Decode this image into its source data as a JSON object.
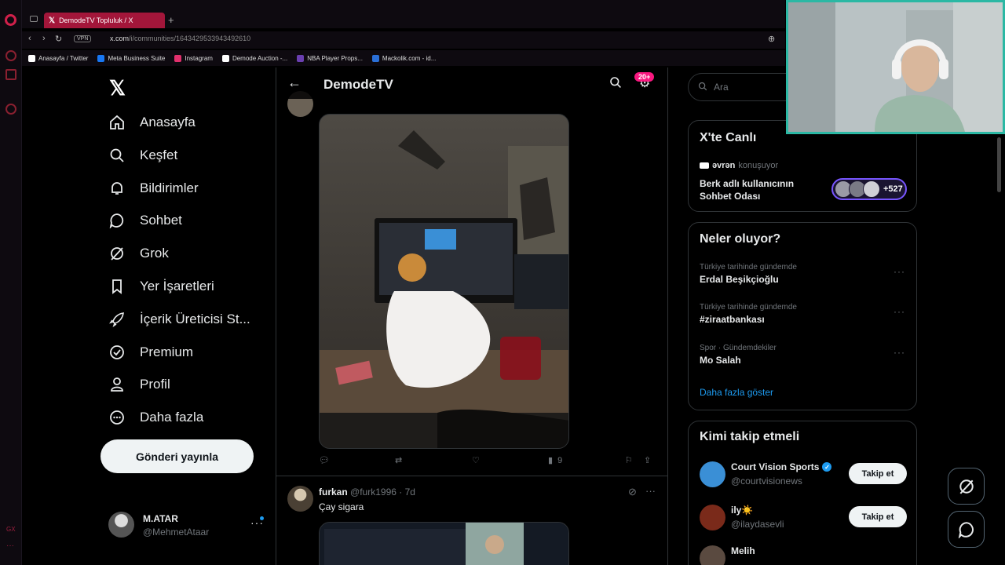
{
  "browser": {
    "tab_title": "DemodeTV Topluluk / X",
    "url_host": "x.com",
    "url_path": "/i/communities/1643429533943492610",
    "vpn_label": "VPN",
    "bookmarks": [
      {
        "label": "Anasayfa / Twitter",
        "color": "#ffffff"
      },
      {
        "label": "Meta Business Suite",
        "color": "#1877f2"
      },
      {
        "label": "Instagram",
        "color": "#e1306c"
      },
      {
        "label": "Demode Auction -...",
        "color": "#ffffff"
      },
      {
        "label": "NBA Player Props...",
        "color": "#6a3fb0"
      },
      {
        "label": "Mackolik.com - id...",
        "color": "#2a6fd6"
      }
    ],
    "rail_label": "GX"
  },
  "sidebar": {
    "items": [
      {
        "label": "Anasayfa",
        "icon": "home-icon"
      },
      {
        "label": "Keşfet",
        "icon": "search-icon"
      },
      {
        "label": "Bildirimler",
        "icon": "bell-icon"
      },
      {
        "label": "Sohbet",
        "icon": "chat-icon"
      },
      {
        "label": "Grok",
        "icon": "grok-icon"
      },
      {
        "label": "Yer İşaretleri",
        "icon": "bookmark-icon"
      },
      {
        "label": "İçerik Üreticisi St...",
        "icon": "rocket-icon"
      },
      {
        "label": "Premium",
        "icon": "verified-icon"
      },
      {
        "label": "Profil",
        "icon": "person-icon"
      },
      {
        "label": "Daha fazla",
        "icon": "more-circle-icon"
      }
    ],
    "post_button": "Gönderi yayınla",
    "account": {
      "name": "M.ATAR",
      "handle": "@MehmetAtaar"
    }
  },
  "main": {
    "title": "DemodeTV",
    "badge": "20+",
    "tweet1": {
      "views": "9"
    },
    "tweet2": {
      "name": "furkan",
      "handle": "@furk1996",
      "time": "· 7d",
      "text": "Çay sigara"
    }
  },
  "right": {
    "search_placeholder": "Ara",
    "live": {
      "title": "X'te Canlı",
      "speaker": "əvrən",
      "speaking": "konuşuyor",
      "room_title": "Berk adlı kullanıcının Sohbet Odası",
      "listeners": "+527"
    },
    "trends": {
      "title": "Neler oluyor?",
      "items": [
        {
          "meta": "Türkiye tarihinde gündemde",
          "name": "Erdal Beşikçioğlu"
        },
        {
          "meta": "Türkiye tarihinde gündemde",
          "name": "#ziraatbankası"
        },
        {
          "meta": "Spor · Gündemdekiler",
          "name": "Mo Salah"
        }
      ],
      "show_more": "Daha fazla göster"
    },
    "who": {
      "title": "Kimi takip etmeli",
      "items": [
        {
          "name": "Court Vision Sports",
          "handle": "@courtvisionews",
          "follow": "Takip et",
          "verified": true,
          "color": "#3a8fd6"
        },
        {
          "name": "ily☀️",
          "handle": "@ilaydasevli",
          "follow": "Takip et",
          "verified": false,
          "color": "#7a2a1a"
        },
        {
          "name": "Melih",
          "handle": "",
          "follow": "",
          "verified": false,
          "color": "#5a4a40"
        }
      ]
    }
  },
  "colors": {
    "accent": "#1d9bf0",
    "opera": "#a3163a",
    "live_border": "#7856ff",
    "webcam_border": "#2bb8a4"
  }
}
